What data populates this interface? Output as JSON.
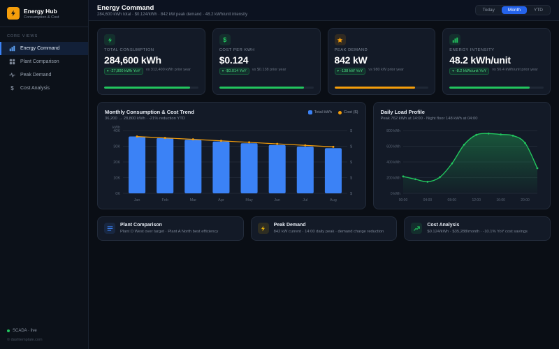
{
  "colors": {
    "accent_blue": "#3b82f6",
    "green": "#22c55e",
    "orange": "#f59e0b",
    "yellow": "#eab308",
    "background": "#0a0e15",
    "card": "#131a27"
  },
  "sidebar": {
    "logo": {
      "title": "Energy Hub",
      "subtitle": "Consumption & Cost"
    },
    "section_label": "CORE VIEWS",
    "items": [
      {
        "label": "Energy Command",
        "active": true
      },
      {
        "label": "Plant Comparison",
        "active": false
      },
      {
        "label": "Peak Demand",
        "active": false
      },
      {
        "label": "Cost Analysis",
        "active": false
      }
    ],
    "status": "SCADA · live",
    "footer": "© dashtemplate.com"
  },
  "header": {
    "title": "Energy Command",
    "subtitle": "284,600 kWh total · $0.124/kWh · 842 kW peak demand · 48.2 kWh/unit intensity",
    "range_buttons": [
      {
        "label": "Today",
        "active": false
      },
      {
        "label": "Month",
        "active": true
      },
      {
        "label": "YTD",
        "active": false
      }
    ]
  },
  "kpis": [
    {
      "title": "TOTAL CONSUMPTION",
      "value": "284,600 kWh",
      "badge": "-27,800 kWh YoY",
      "compare": "vs 312,400 kWh prior year",
      "progress": 0.91,
      "icon": "lightning-icon",
      "icon_color": "#22c55e",
      "bar_color": "#22c55e"
    },
    {
      "title": "COST PER KWH",
      "value": "$0.124",
      "badge": "-$0.014 YoY",
      "compare": "vs $0.138 prior year",
      "progress": 0.9,
      "icon": "dollar-icon",
      "icon_color": "#22c55e",
      "bar_color": "#22c55e"
    },
    {
      "title": "PEAK DEMAND",
      "value": "842 kW",
      "badge": "-138 kW YoY",
      "compare": "vs 980 kW prior year",
      "progress": 0.86,
      "icon": "star-icon",
      "icon_color": "#f59e0b",
      "bar_color": "#f59e0b"
    },
    {
      "title": "ENERGY INTENSITY",
      "value": "48.2 kWh/unit",
      "badge": "-8.2 kWh/unit YoY",
      "compare": "vs 56.4 kWh/unit prior year",
      "progress": 0.85,
      "icon": "bar-chart-icon",
      "icon_color": "#22c55e",
      "bar_color": "#22c55e"
    }
  ],
  "chart_data": [
    {
      "type": "bar",
      "title": "Monthly Consumption & Cost Trend",
      "subtitle": "36,200 → 28,800 kWh · -21% reduction YTD",
      "categories": [
        "Jan",
        "Feb",
        "Mar",
        "Apr",
        "May",
        "Jun",
        "Jul",
        "Aug"
      ],
      "series": [
        {
          "name": "Total kWh",
          "type": "bar",
          "color": "#3b82f6",
          "values": [
            36200,
            35200,
            34100,
            33000,
            31900,
            30800,
            29800,
            28800
          ]
        },
        {
          "name": "Cost ($)",
          "type": "line",
          "color": "#f59e0b",
          "values": [
            4520,
            4410,
            4300,
            4180,
            4060,
            3940,
            3820,
            3700
          ]
        }
      ],
      "ylabel_left": "kWh",
      "yticks_left": [
        "0K",
        "10K",
        "20K",
        "30K",
        "40K"
      ],
      "ylim_left": [
        0,
        40000
      ],
      "yticks_right": [
        "$",
        "$",
        "$",
        "$",
        "$"
      ],
      "ylim_right": [
        0,
        5000
      ],
      "legend_position": "top-right",
      "grid": true
    },
    {
      "type": "area",
      "title": "Daily Load Profile",
      "subtitle": "Peak 762 kWh at 14:00 · Night floor 148 kWh at 04:00",
      "x": [
        "00:00",
        "02:00",
        "04:00",
        "06:00",
        "08:00",
        "10:00",
        "12:00",
        "14:00",
        "16:00",
        "18:00",
        "20:00",
        "22:00"
      ],
      "values": [
        215,
        180,
        148,
        205,
        380,
        620,
        745,
        762,
        750,
        735,
        640,
        320
      ],
      "color": "#22c55e",
      "yticks": [
        "0 kWh",
        "200 kWh",
        "400 kWh",
        "600 kWh",
        "800 kWh"
      ],
      "ylim": [
        0,
        800
      ],
      "xticks": [
        "00:00",
        "04:00",
        "08:00",
        "12:00",
        "16:00",
        "20:00"
      ],
      "grid": true
    }
  ],
  "summaries": [
    {
      "title": "Plant Comparison",
      "desc": "Plant D West over target · Plant A North best efficiency",
      "icon": "list-icon",
      "color": "#3b82f6"
    },
    {
      "title": "Peak Demand",
      "desc": "842 kW current · 14:00 daily peak · demand charge reduction",
      "icon": "lightning-icon",
      "color": "#eab308"
    },
    {
      "title": "Cost Analysis",
      "desc": "$0.124/kWh · $35,288/month · -10.1% YoY cost savings",
      "icon": "trend-up-icon",
      "color": "#22c55e"
    }
  ]
}
